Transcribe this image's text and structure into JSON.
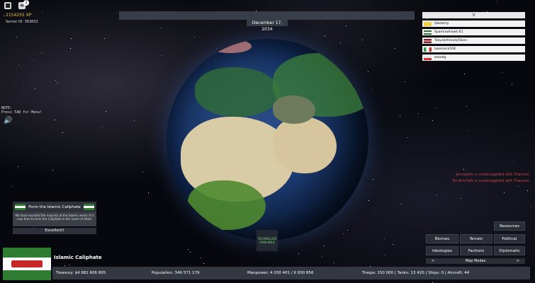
{
  "hud": {
    "xp": "2154255 XP",
    "server_id": "Server ID: 363832",
    "notification_count": "1",
    "note_line1": "NOTE:",
    "note_line2": "Press TAB for Menu!",
    "date": "December 17, 2034"
  },
  "players": {
    "header": "V",
    "list": [
      {
        "name": "Qwebirty",
        "flag_color": "#f4d03f"
      },
      {
        "name": "Spamrowhawk.tt1",
        "flag_color": "#2e7d32"
      },
      {
        "name": "TokyoIsAlreadyTaken",
        "flag_color": "#8b1e2b"
      },
      {
        "name": "lukenieck108",
        "flag_color": "#2e9e44"
      },
      {
        "name": "zeeedg",
        "flag_color": "#e8e8e8"
      }
    ]
  },
  "alerts": [
    "Jerusalem is undersupplied with Titanium",
    "Tel Aviv-Yafo is undersupplied with Titanium"
  ],
  "popup": {
    "title": "Form the Islamic Caliphate",
    "body": "We have reunited the majority of the Islamic world. It is now time to form the Caliphate in the name of Allah!",
    "button": "Excellent!"
  },
  "tech": {
    "line1": "TECHNOLOGY",
    "line2": "AVAILABLE"
  },
  "nation": {
    "name": "Islamic Caliphate",
    "treasury_label": "Treasury:",
    "treasury": "$4 981 606 805",
    "population_label": "Population:",
    "population": "346 571 179",
    "manpower_label": "Manpower:",
    "manpower": "4 030 401  /  6 930 856",
    "troops_label": "Troops:",
    "troops": "150 000",
    "tanks_label": "Tanks:",
    "tanks": "13 420",
    "ships_label": "Ships:",
    "ships": "0",
    "aircraft_label": "Aircraft:",
    "aircraft": "44"
  },
  "buttons": {
    "resources": "Resources",
    "biomes": "Biomes",
    "terrain": "Terrain",
    "political": "Political",
    "ideologies": "Ideologies",
    "factions": "Factions",
    "diplomatic": "Diplomatic",
    "map_modes": "Map Modes",
    "prev": "<",
    "next": ">"
  },
  "colors": {
    "accent_xp": "#f1c232",
    "alert": "#cc4444",
    "tech_text": "#7dd87d",
    "panel": "#2a2e36"
  }
}
